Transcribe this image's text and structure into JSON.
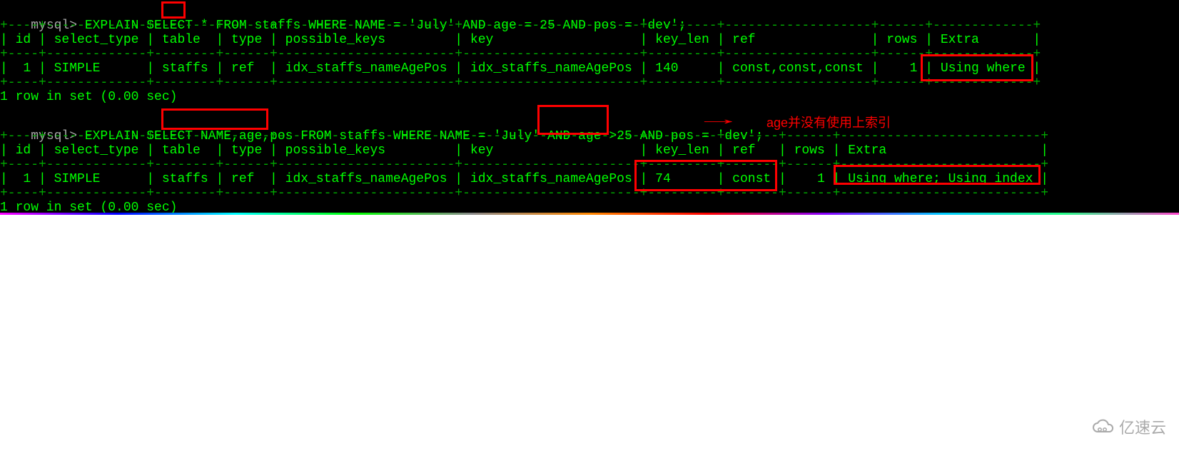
{
  "prompt": "mysql>",
  "query1": {
    "prefix": " EXPLAIN SELECT ",
    "star": "*",
    "suffix": " FROM staffs WHERE NAME = 'July' AND age = 25 AND pos = 'dev';"
  },
  "table1": {
    "border_top": "+----+-------------+--------+------+-----------------------+-----------------------+---------+-------------------+------+-------------+",
    "header": "| id | select_type | table  | type | possible_keys         | key                   | key_len | ref               | rows | Extra       |",
    "border_mid": "+----+-------------+--------+------+-----------------------+-----------------------+---------+-------------------+------+-------------+",
    "row": "|  1 | SIMPLE      | staffs | ref  | idx_staffs_nameAgePos | idx_staffs_nameAgePos | 140     | const,const,const |    1 | Using where |",
    "border_bot": "+----+-------------+--------+------+-----------------------+-----------------------+---------+-------------------+------+-------------+",
    "footer": "1 row in set (0.00 sec)",
    "columns": [
      "id",
      "select_type",
      "table",
      "type",
      "possible_keys",
      "key",
      "key_len",
      "ref",
      "rows",
      "Extra"
    ],
    "data": {
      "id": "1",
      "select_type": "SIMPLE",
      "table": "staffs",
      "type": "ref",
      "possible_keys": "idx_staffs_nameAgePos",
      "key": "idx_staffs_nameAgePos",
      "key_len": "140",
      "ref": "const,const,const",
      "rows": "1",
      "Extra": "Using where"
    }
  },
  "query2": {
    "prefix": " EXPLAIN SELECT ",
    "cols": "NAME,age,pos",
    "mid1": " FROM staffs WHERE NAME = 'July' AND ",
    "age": "age >25",
    "mid2": " AND pos = 'dev';"
  },
  "table2": {
    "border_top": "+----+-------------+--------+------+-----------------------+-----------------------+---------+-------+------+--------------------------+",
    "header": "| id | select_type | table  | type | possible_keys         | key                   | key_len | ref   | rows | Extra                    |",
    "border_mid": "+----+-------------+--------+------+-----------------------+-----------------------+---------+-------+------+--------------------------+",
    "row": "|  1 | SIMPLE      | staffs | ref  | idx_staffs_nameAgePos | idx_staffs_nameAgePos | 74      | const |    1 | Using where; Using index |",
    "border_bot": "+----+-------------+--------+------+-----------------------+-----------------------+---------+-------+------+--------------------------+",
    "footer": "1 row in set (0.00 sec)",
    "columns": [
      "id",
      "select_type",
      "table",
      "type",
      "possible_keys",
      "key",
      "key_len",
      "ref",
      "rows",
      "Extra"
    ],
    "data": {
      "id": "1",
      "select_type": "SIMPLE",
      "table": "staffs",
      "type": "ref",
      "possible_keys": "idx_staffs_nameAgePos",
      "key": "idx_staffs_nameAgePos",
      "key_len": "74",
      "ref": "const",
      "rows": "1",
      "Extra": "Using where; Using index"
    }
  },
  "annotation": {
    "arrow": "→",
    "text": "age并没有使用上索引"
  },
  "watermark": "亿速云"
}
